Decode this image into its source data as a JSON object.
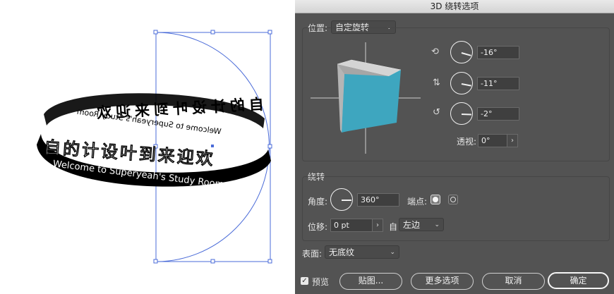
{
  "artwork": {
    "ring_cn_text": "自的计设叶到来迎欢",
    "ring_en_text": "Welcome to Superyeah's Study Room"
  },
  "dialog": {
    "title": "3D 绕转选项",
    "position_label": "位置:",
    "position_value": "自定旋转",
    "rotation_x": "-16°",
    "rotation_y": "-11°",
    "rotation_z": "-2°",
    "perspective_label": "透视:",
    "perspective_value": "0°",
    "revolve_section": "绕转",
    "angle_label": "角度:",
    "angle_value": "360°",
    "cap_label": "端点:",
    "offset_label": "位移:",
    "offset_value": "0 pt",
    "offset_from_label": "自",
    "offset_from_value": "左边",
    "surface_label": "表面:",
    "surface_value": "无底纹",
    "preview_label": "预览",
    "map_art_button": "贴图...",
    "more_options_button": "更多选项",
    "cancel_button": "取消",
    "ok_button": "确定"
  },
  "icons": {
    "chevron": "⌄",
    "step_arrow": "›",
    "check": "✓"
  },
  "colors": {
    "cube_front": "#3ea6bf",
    "cube_top": "#d4d4d4",
    "cube_side": "#a6a6a6",
    "dialog_bg": "#535353",
    "selection_blue": "#4a6bd8"
  }
}
